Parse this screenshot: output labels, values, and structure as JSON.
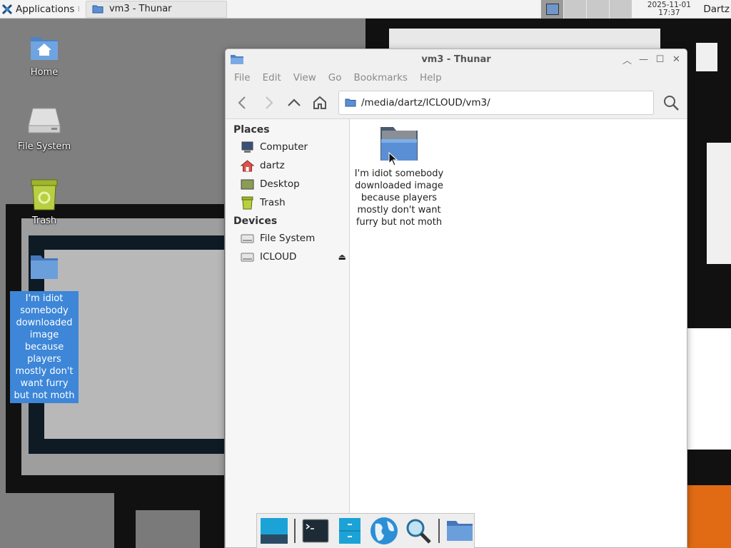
{
  "panel": {
    "apps_label": "Applications",
    "task_title": "vm3 - Thunar",
    "clock_date": "2025-11-01",
    "clock_time": "17:37",
    "user": "Dartz"
  },
  "desktop": {
    "icons": [
      {
        "label": "Home"
      },
      {
        "label": "File System"
      },
      {
        "label": "Trash"
      },
      {
        "label": "I'm idiot somebody downloaded image because players mostly don't want furry but not moth"
      }
    ]
  },
  "window": {
    "title": "vm3 - Thunar",
    "menu": [
      "File",
      "Edit",
      "View",
      "Go",
      "Bookmarks",
      "Help"
    ],
    "path": "/media/dartz/ICLOUD/vm3/",
    "sidebar": {
      "places_heading": "Places",
      "places": [
        "Computer",
        "dartz",
        "Desktop",
        "Trash"
      ],
      "devices_heading": "Devices",
      "devices": [
        "File System",
        "ICLOUD"
      ]
    },
    "files": [
      {
        "name": "I'm idiot somebody downloaded image because players mostly don't want furry but not moth"
      }
    ]
  },
  "colors": {
    "accent": "#3d86d8",
    "folder": "#5b8fd4"
  }
}
